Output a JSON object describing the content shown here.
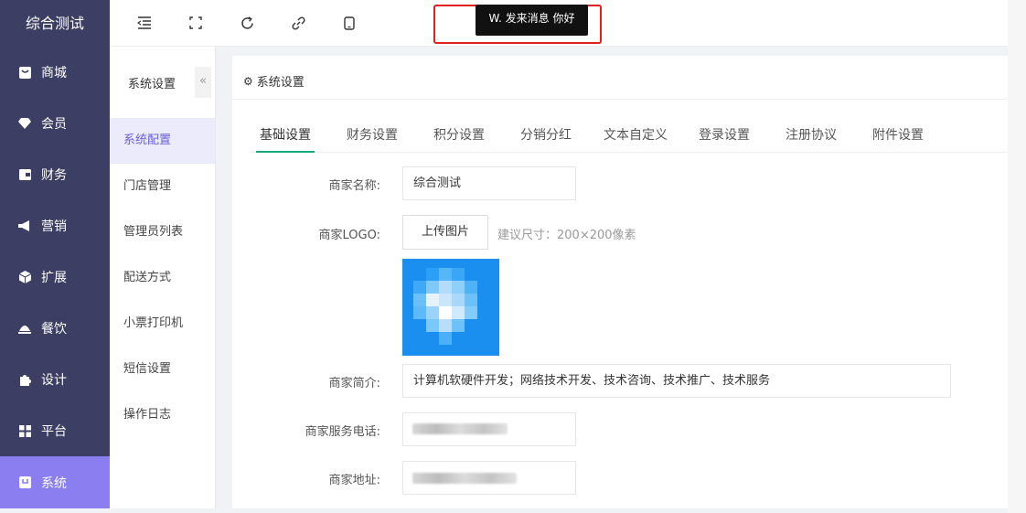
{
  "brand": "综合测试",
  "sidebar": {
    "items": [
      {
        "label": "商城",
        "icon": "shop-icon"
      },
      {
        "label": "会员",
        "icon": "member-icon"
      },
      {
        "label": "财务",
        "icon": "finance-icon"
      },
      {
        "label": "营销",
        "icon": "megaphone-icon"
      },
      {
        "label": "扩展",
        "icon": "cube-icon"
      },
      {
        "label": "餐饮",
        "icon": "cloche-icon"
      },
      {
        "label": "设计",
        "icon": "puzzle-icon"
      },
      {
        "label": "平台",
        "icon": "grid-icon"
      },
      {
        "label": "系统",
        "icon": "system-icon"
      }
    ],
    "active_index": 8
  },
  "header": {
    "tooltip": "W. 发来消息 你好",
    "icons": [
      "collapse-menu-icon",
      "fullscreen-icon",
      "refresh-icon",
      "link-icon",
      "mobile-icon"
    ]
  },
  "subnav": {
    "title": "系统设置",
    "collapse_glyph": "«",
    "items": [
      "系统配置",
      "门店管理",
      "管理员列表",
      "配送方式",
      "小票打印机",
      "短信设置",
      "操作日志"
    ],
    "active_index": 0
  },
  "main": {
    "title": "系统设置",
    "tabs": [
      "基础设置",
      "财务设置",
      "积分设置",
      "分销分红",
      "文本自定义",
      "登录设置",
      "注册协议",
      "附件设置"
    ],
    "active_tab": 0,
    "form": {
      "name_label": "商家名称:",
      "name_value": "综合测试",
      "logo_label": "商家LOGO:",
      "upload_label": "上传图片",
      "logo_hint": "建议尺寸：200×200像素",
      "intro_label": "商家简介:",
      "intro_value": "计算机软硬件开发；网络技术开发、技术咨询、技术推广、技术服务",
      "phone_label": "商家服务电话:",
      "address_label": "商家地址:"
    }
  },
  "colors": {
    "sidebar_bg": "#3c3f63",
    "sidebar_active": "#8a7ef0",
    "subnav_active_bg": "#ecebfb",
    "subnav_active_text": "#6a60d8",
    "tab_underline": "#19a974",
    "highlight_border": "#e02020",
    "logo_blue": "#1e97f3"
  }
}
